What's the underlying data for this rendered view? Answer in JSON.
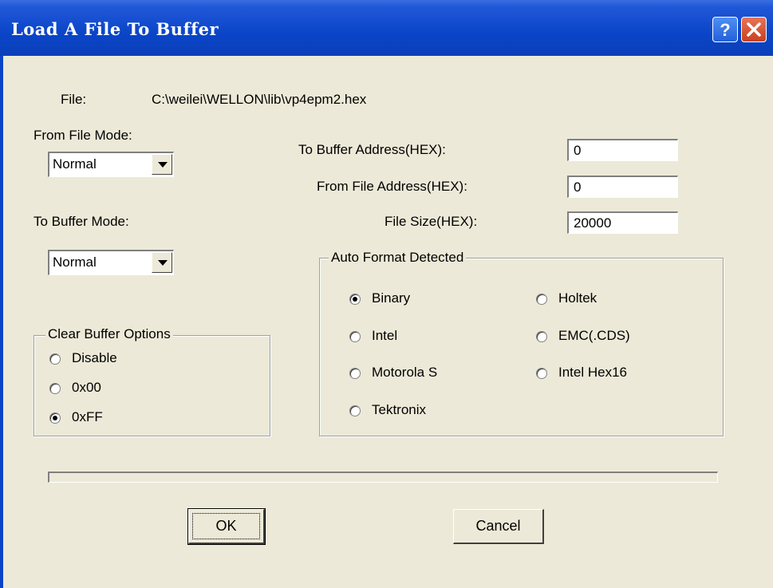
{
  "window": {
    "title": "Load A File To Buffer"
  },
  "file": {
    "label": "File:",
    "path": "C:\\weilei\\WELLON\\lib\\vp4epm2.hex"
  },
  "from_file_mode": {
    "label": "From File Mode:",
    "value": "Normal"
  },
  "to_buffer_mode": {
    "label": "To Buffer Mode:",
    "value": "Normal"
  },
  "to_buffer_address": {
    "label": "To Buffer Address(HEX):",
    "value": "0"
  },
  "from_file_address": {
    "label": "From File Address(HEX):",
    "value": "0"
  },
  "file_size": {
    "label": "File Size(HEX):",
    "value": "20000"
  },
  "clear_buffer": {
    "title": "Clear Buffer Options",
    "options": [
      "Disable",
      "0x00",
      "0xFF"
    ],
    "selected": "0xFF"
  },
  "auto_format": {
    "title": "Auto Format Detected",
    "options": [
      "Binary",
      "Intel",
      "Motorola S",
      "Tektronix",
      "Holtek",
      "EMC(.CDS)",
      "Intel Hex16"
    ],
    "selected": "Binary"
  },
  "progress": {
    "value": 0
  },
  "buttons": {
    "ok": "OK",
    "cancel": "Cancel"
  },
  "icons": {
    "help": "help-icon",
    "close": "close-icon",
    "dropdown": "chevron-down-icon"
  },
  "colors": {
    "titlebar": "#0a45c8",
    "dialog_bg": "#ece9d8",
    "close_button": "#d8502e"
  }
}
